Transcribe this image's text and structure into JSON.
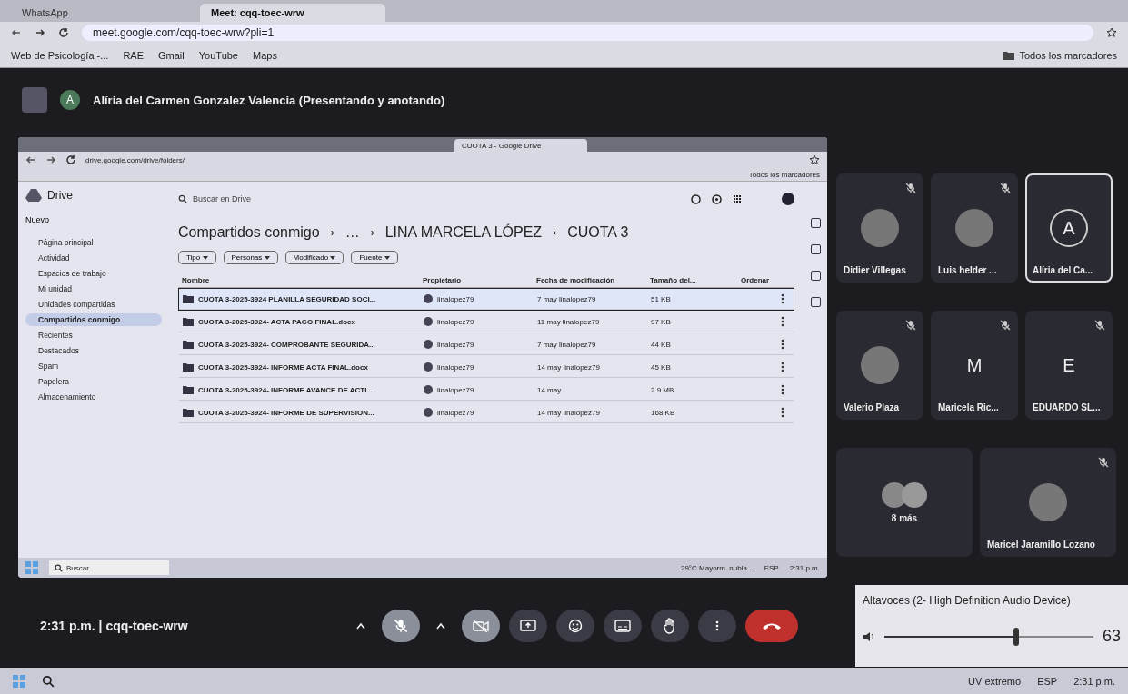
{
  "browser": {
    "tabs": [
      {
        "label": "WhatsApp",
        "selected": false
      },
      {
        "label": "Meet: cqq-toec-wrw",
        "selected": true
      }
    ],
    "url": "meet.google.com/cqq-toec-wrw?pli=1",
    "bookmarks": [
      "Web de Psicología -...",
      "RAE",
      "Gmail",
      "YouTube",
      "Maps"
    ],
    "all_bookmarks": "Todos los marcadores"
  },
  "meet": {
    "presenter_initial": "A",
    "presenter": "Alíria del Carmen Gonzalez Valencia (Presentando y anotando)",
    "shared_screen": {
      "tabs": [
        {
          "label": "CUOTA 3 - Google Drive",
          "selected": true
        }
      ],
      "url": "drive.google.com/drive/folders/",
      "all_bookmarks": "Todos los marcadores",
      "drive": {
        "logo": "Drive",
        "search_placeholder": "Buscar en Drive",
        "new_button": "Nuevo",
        "nav": [
          {
            "label": "Página principal",
            "selected": false
          },
          {
            "label": "Actividad",
            "selected": false
          },
          {
            "label": "Espacios de trabajo",
            "selected": false
          },
          {
            "label": "Mi unidad",
            "selected": false
          },
          {
            "label": "Unidades compartidas",
            "selected": false
          },
          {
            "label": "Compartidos conmigo",
            "selected": true
          },
          {
            "label": "Recientes",
            "selected": false
          },
          {
            "label": "Destacados",
            "selected": false
          },
          {
            "label": "Spam",
            "selected": false
          },
          {
            "label": "Papelera",
            "selected": false
          },
          {
            "label": "Almacenamiento",
            "selected": false
          }
        ],
        "breadcrumb": [
          {
            "kind": "link",
            "text": "Compartidos conmigo"
          },
          {
            "kind": "separator",
            "text": "›"
          },
          {
            "kind": "link",
            "text": "…"
          },
          {
            "kind": "separator",
            "text": "›"
          },
          {
            "kind": "link",
            "text": "LINA MARCELA LÓPEZ"
          },
          {
            "kind": "separator",
            "text": "›"
          },
          {
            "kind": "link",
            "text": "CUOTA 3"
          }
        ],
        "filters": [
          "Tipo",
          "Personas",
          "Modificado",
          "Fuente"
        ],
        "columns": [
          "Nombre",
          "Propietario",
          "Fecha de modificación",
          "Tamaño del...",
          "Ordenar"
        ],
        "rows": [
          {
            "name": "CUOTA 3-2025-3924 PLANILLA SEGURIDAD SOCI...",
            "owner": "linalopez79",
            "modified": "7 may linalopez79",
            "size": "51 KB",
            "selected": true
          },
          {
            "name": "CUOTA 3-2025-3924- ACTA PAGO FINAL.docx",
            "owner": "linalopez79",
            "modified": "11 may linalopez79",
            "size": "97 KB",
            "selected": false
          },
          {
            "name": "CUOTA 3-2025-3924- COMPROBANTE SEGURIDA...",
            "owner": "linalopez79",
            "modified": "7 may linalopez79",
            "size": "44 KB",
            "selected": false
          },
          {
            "name": "CUOTA 3-2025-3924- INFORME ACTA FINAL.docx",
            "owner": "linalopez79",
            "modified": "14 may linalopez79",
            "size": "45 KB",
            "selected": false
          },
          {
            "name": "CUOTA 3-2025-3924- INFORME AVANCE DE ACTI...",
            "owner": "linalopez79",
            "modified": "14 may",
            "size": "2.9 MB",
            "selected": false
          },
          {
            "name": "CUOTA 3-2025-3924- INFORME DE SUPERVISION...",
            "owner": "linalopez79",
            "modified": "14 may linalopez79",
            "size": "168 KB",
            "selected": false
          }
        ]
      },
      "taskbar": {
        "search": "Buscar",
        "weather": "29°C Mayorm. nubla...",
        "language": "ESP",
        "time": "2:31 p.m."
      }
    },
    "tiles": [
      {
        "name": "Didier Villegas",
        "kind": "photo",
        "muted": true,
        "selected": false
      },
      {
        "name": "Luis helder ...",
        "kind": "photo",
        "muted": true,
        "selected": false
      },
      {
        "name": "Alíria del Ca...",
        "kind": "letter",
        "initial": "A",
        "muted": false,
        "selected": true
      },
      {
        "name": "Valerio Plaza",
        "kind": "photo",
        "muted": true,
        "selected": false
      },
      {
        "name": "Maricela Ric...",
        "kind": "letter",
        "initial": "M",
        "muted": true,
        "selected": false
      },
      {
        "name": "EDUARDO SL...",
        "kind": "letter",
        "initial": "E",
        "muted": true,
        "selected": false
      },
      {
        "name": "8 más",
        "kind": "group",
        "muted": false,
        "selected": false
      },
      {
        "name": "Maricel Jaramillo Lozano",
        "kind": "photo",
        "muted": true,
        "selected": false
      }
    ],
    "time_code": "2:31 p.m. | cqq-toec-wrw",
    "device_controls": [
      {
        "kind": "mic",
        "off": true
      },
      {
        "kind": "camera",
        "off": true
      }
    ],
    "controls": [
      {
        "kind": "present"
      },
      {
        "kind": "emoji"
      },
      {
        "kind": "captions"
      },
      {
        "kind": "hand"
      },
      {
        "kind": "more"
      },
      {
        "kind": "hangup"
      }
    ],
    "volume": {
      "device": "Altavoces (2- High Definition Audio Device)",
      "level": 0.63,
      "reading": "63"
    }
  },
  "windows_taskbar": {
    "uv": "UV extremo",
    "language": "ESP",
    "time": "2:31 p.m."
  }
}
